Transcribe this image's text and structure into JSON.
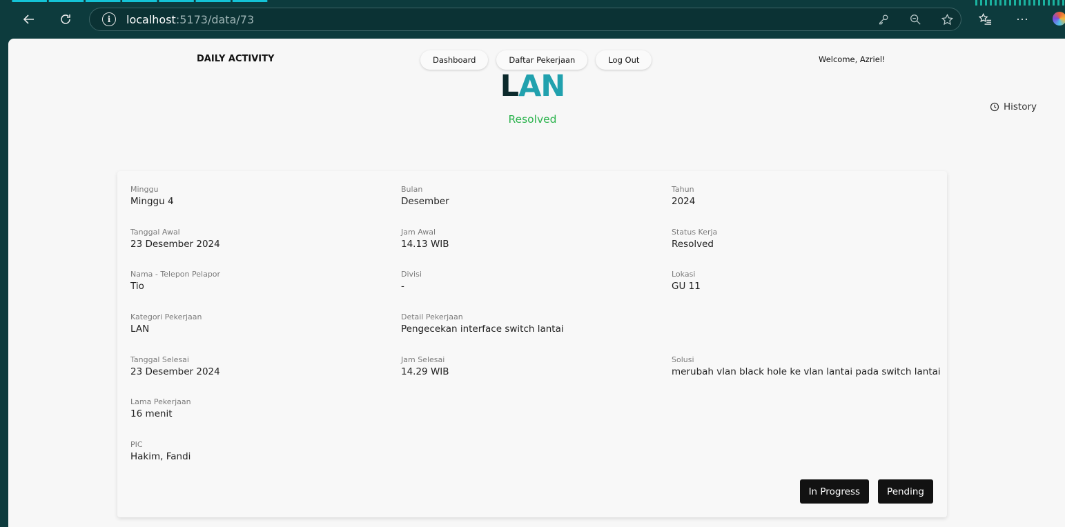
{
  "browser": {
    "url_host": "localhost",
    "url_path": ":5173/data/73",
    "icons": [
      "back-icon",
      "refresh-icon",
      "info-icon",
      "key-icon",
      "zoom-icon",
      "favorite-icon",
      "favorites-list-icon",
      "more-icon",
      "copilot-icon"
    ]
  },
  "navbar": {
    "brand": "DAILY ACTIVITY",
    "links": [
      "Dashboard",
      "Daftar Pekerjaan",
      "Log Out"
    ],
    "welcome": "Welcome, Azriel!"
  },
  "header": {
    "title_first": "L",
    "title_rest": "AN",
    "status": "Resolved",
    "history_label": "History",
    "colors": {
      "title_dark": "#0c2a2c",
      "title_accent": "#21a1ae",
      "status": "#2bb34d"
    }
  },
  "details": [
    {
      "label": "Minggu",
      "value": "Minggu 4"
    },
    {
      "label": "Bulan",
      "value": "Desember"
    },
    {
      "label": "Tahun",
      "value": "2024"
    },
    {
      "label": "Tanggal Awal",
      "value": "23 Desember 2024"
    },
    {
      "label": "Jam Awal",
      "value": "14.13 WIB"
    },
    {
      "label": "Status Kerja",
      "value": "Resolved"
    },
    {
      "label": "Nama - Telepon Pelapor",
      "value": "Tio"
    },
    {
      "label": "Divisi",
      "value": "-"
    },
    {
      "label": "Lokasi",
      "value": "GU 11"
    },
    {
      "label": "Kategori Pekerjaan",
      "value": "LAN"
    },
    {
      "label": "Detail Pekerjaan",
      "value": "Pengecekan interface switch lantai"
    },
    {
      "label": "",
      "value": ""
    },
    {
      "label": "Tanggal Selesai",
      "value": "23 Desember 2024"
    },
    {
      "label": "Jam Selesai",
      "value": "14.29 WIB"
    },
    {
      "label": "Solusi",
      "value": "merubah vlan black hole ke vlan lantai pada switch lantai"
    },
    {
      "label": "Lama Pekerjaan",
      "value": "16 menit"
    },
    {
      "label": "",
      "value": ""
    },
    {
      "label": "",
      "value": ""
    },
    {
      "label": "PIC",
      "value": "Hakim, Fandi"
    }
  ],
  "actions": {
    "in_progress": "In Progress",
    "pending": "Pending"
  }
}
